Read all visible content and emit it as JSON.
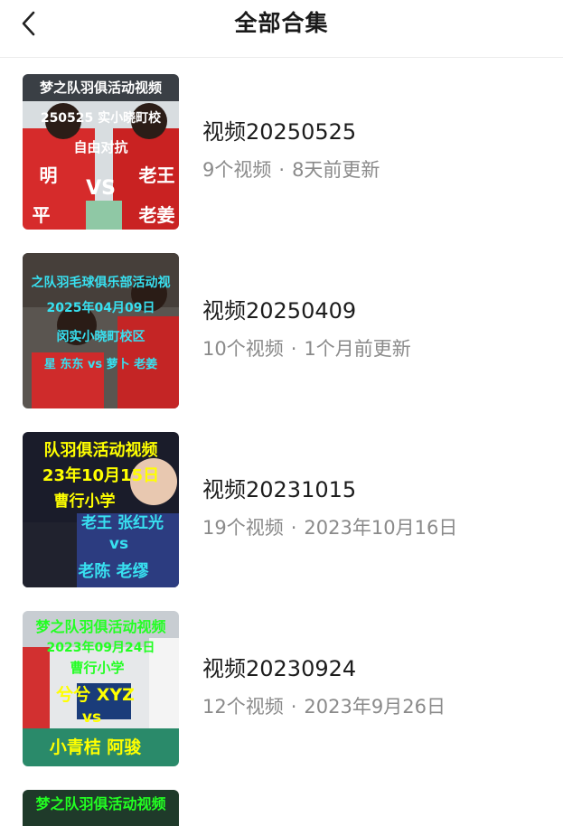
{
  "header": {
    "title": "全部合集",
    "back_icon": "chevron-left-icon"
  },
  "items": [
    {
      "name": "视频20250525",
      "count": "9个视频",
      "updated": "8天前更新",
      "thumb_lines": [
        "梦之队羽俱活动视频",
        "250525 实小晓町校",
        "自由对抗",
        "明",
        "老王",
        "VS",
        "平",
        "老姜"
      ]
    },
    {
      "name": "视频20250409",
      "count": "10个视频",
      "updated": "1个月前更新",
      "thumb_lines": [
        "之队羽毛球俱乐部活动视",
        "2025年04月09日",
        "闵实小晓町校区",
        "星 东东 vs 萝卜 老姜"
      ]
    },
    {
      "name": "视频20231015",
      "count": "19个视频",
      "updated": "2023年10月16日",
      "thumb_lines": [
        "队羽俱活动视频",
        "23年10月15日",
        "曹行小学",
        "老王 张红光",
        "vs",
        "老陈 老缪"
      ]
    },
    {
      "name": "视频20230924",
      "count": "12个视频",
      "updated": "2023年9月26日",
      "thumb_lines": [
        "梦之队羽俱活动视频",
        "2023年09月24日",
        "曹行小学",
        "兮兮 XYZ",
        "vs",
        "小青桔 阿骏"
      ]
    },
    {
      "thumb_lines": [
        "梦之队羽俱活动视频"
      ]
    }
  ],
  "separator": "·"
}
